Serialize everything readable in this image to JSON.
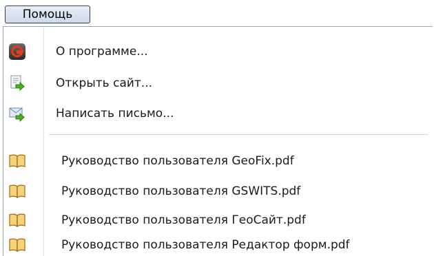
{
  "menubar": {
    "help_label": "Помощь"
  },
  "menu": {
    "items": [
      {
        "label": "О программе...",
        "icon": "app-logo-icon"
      },
      {
        "label": "Открыть сайт...",
        "icon": "open-site-icon"
      },
      {
        "label": "Написать письмо...",
        "icon": "send-mail-icon"
      }
    ],
    "manuals": [
      {
        "label": "Руководство пользователя GeoFix.pdf",
        "icon": "book-icon"
      },
      {
        "label": "Руководство пользователя GSWITS.pdf",
        "icon": "book-icon"
      },
      {
        "label": "Руководство пользователя ГеоСайт.pdf",
        "icon": "book-icon"
      },
      {
        "label": "Руководство пользователя Редактор форм.pdf",
        "icon": "book-icon"
      }
    ]
  },
  "colors": {
    "logo_red": "#e23b1f",
    "arrow_green": "#4caf26",
    "book_orange": "#d98a1f"
  }
}
